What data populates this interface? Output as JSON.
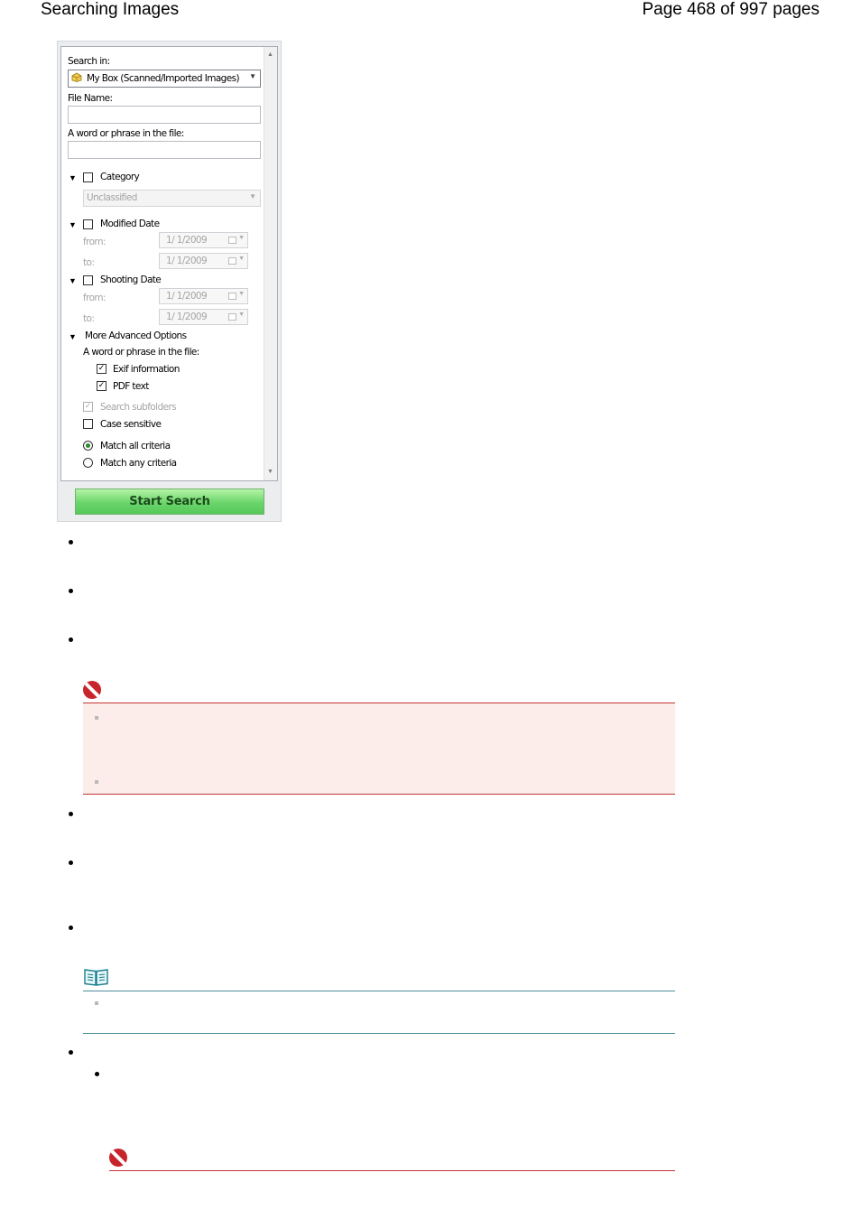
{
  "header": {
    "left_title": "Searching Images",
    "right_page": "Page 468 of 997 pages"
  },
  "search_panel": {
    "search_in_label": "Search in:",
    "search_in_value": "My Box (Scanned/Imported Images)",
    "file_name_label": "File Name:",
    "file_name_value": "",
    "word_phrase_label": "A word or phrase in the file:",
    "word_phrase_value": "",
    "category": {
      "label": "Category",
      "checked": false,
      "value": "Unclassified"
    },
    "modified_date": {
      "label": "Modified Date",
      "checked": false,
      "from_label": "from:",
      "from_value": "1/  1/2009",
      "to_label": "to:",
      "to_value": "1/  1/2009"
    },
    "shooting_date": {
      "label": "Shooting Date",
      "checked": false,
      "from_label": "from:",
      "from_value": "1/  1/2009",
      "to_label": "to:",
      "to_value": "1/  1/2009"
    },
    "advanced": {
      "label": "More Advanced Options",
      "word_phrase_label": "A word or phrase in the file:",
      "exif_label": "Exif information",
      "exif_checked": true,
      "pdf_label": "PDF text",
      "pdf_checked": true,
      "subfolders_label": "Search subfolders",
      "subfolders_checked": true,
      "case_label": "Case sensitive",
      "case_checked": false,
      "match_all_label": "Match all criteria",
      "match_all_selected": true,
      "match_any_label": "Match any criteria",
      "match_any_selected": false
    },
    "start_button": "Start Search",
    "check_mark": "✓"
  }
}
